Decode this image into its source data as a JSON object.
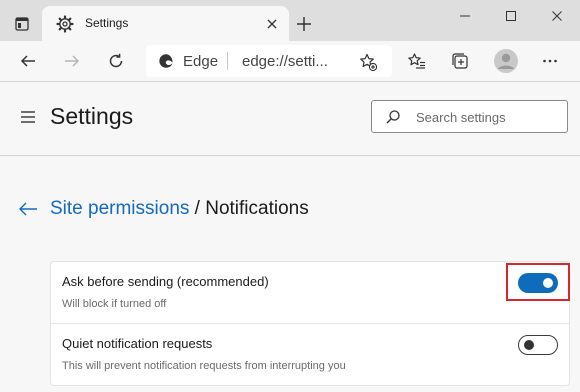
{
  "browser": {
    "tab": {
      "title": "Settings",
      "favicon": "gear-icon"
    },
    "address": {
      "brand": "Edge",
      "url": "edge://setti..."
    },
    "toolbar_icons": [
      "back-icon",
      "forward-icon",
      "refresh-icon",
      "add-favorite-icon",
      "favorites-icon",
      "collections-icon",
      "profile-icon",
      "more-icon"
    ]
  },
  "settings": {
    "title": "Settings",
    "search_placeholder": "Search settings"
  },
  "breadcrumb": {
    "parent": "Site permissions",
    "separator": " / ",
    "current": "Notifications"
  },
  "options": [
    {
      "label": "Ask before sending (recommended)",
      "description": "Will block if turned off",
      "enabled": true
    },
    {
      "label": "Quiet notification requests",
      "description": "This will prevent notification requests from interrupting you",
      "enabled": false
    }
  ],
  "colors": {
    "accent": "#0f6cbd",
    "link": "#1469c4",
    "highlight": "#d9262c"
  }
}
